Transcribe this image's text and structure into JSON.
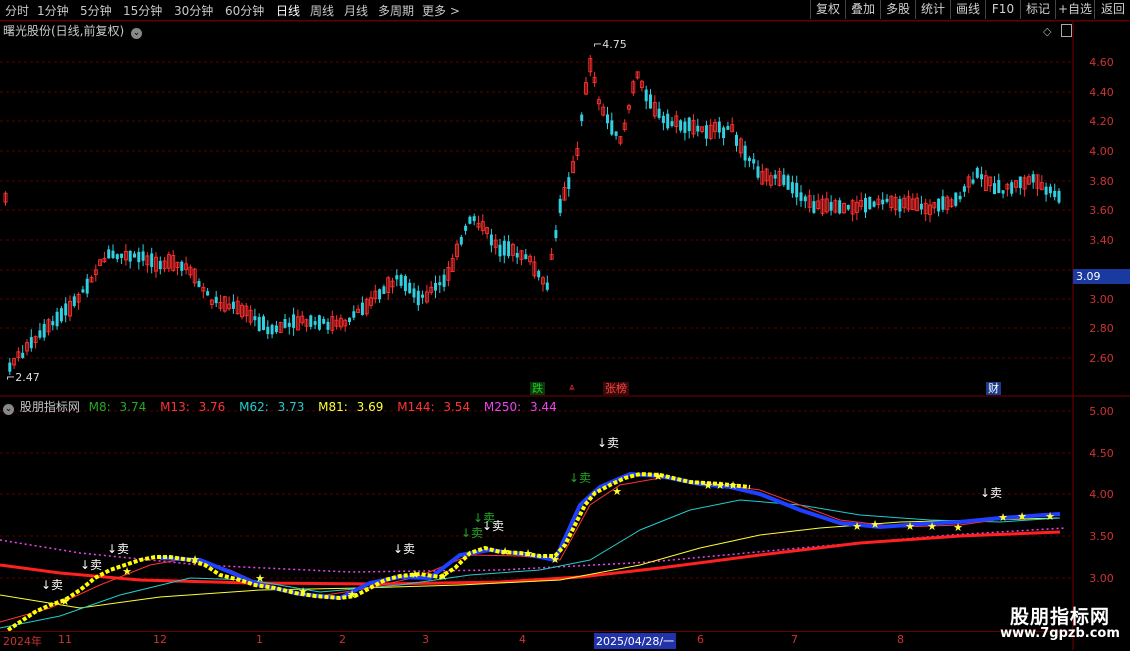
{
  "toolbar": {
    "timeframes": [
      "分时",
      "1分钟",
      "5分钟",
      "15分钟",
      "30分钟",
      "60分钟",
      "日线",
      "周线",
      "月线",
      "多周期",
      "更多 >"
    ],
    "active": "日线",
    "buttons": [
      "复权",
      "叠加",
      "多股",
      "统计",
      "画线",
      "F10",
      "标记",
      "+自选",
      "返回"
    ]
  },
  "price_panel": {
    "title": "曙光股份(日线,前复权)",
    "axis_ticks": [
      "4.60",
      "4.40",
      "4.20",
      "4.00",
      "3.80",
      "3.60",
      "3.40",
      "3.00",
      "2.80",
      "2.60"
    ],
    "current_price": "3.09",
    "high_label": "4.75",
    "low_label": "2.47",
    "tags": [
      {
        "text": "跌",
        "color": "#22aa22",
        "bg": "#0a3a0a"
      },
      {
        "text": "张榜",
        "color": "#ff4444",
        "bg": "#3a0a0a"
      },
      {
        "text": "财",
        "color": "#ffffff",
        "bg": "#1a3a8a"
      }
    ]
  },
  "indicator_panel": {
    "name": "股朋指标网",
    "legend": [
      {
        "label": "M8:",
        "value": "3.74",
        "color": "#22aa22"
      },
      {
        "label": "M13:",
        "value": "3.76",
        "color": "#ff3333"
      },
      {
        "label": "M62:",
        "value": "3.73",
        "color": "#22cccc"
      },
      {
        "label": "M81:",
        "value": "3.69",
        "color": "#ffff33"
      },
      {
        "label": "M144:",
        "value": "3.54",
        "color": "#ff3333"
      },
      {
        "label": "M250:",
        "value": "3.44",
        "color": "#ee44ee"
      }
    ],
    "axis_ticks": [
      "5.00",
      "4.50",
      "4.00",
      "3.50",
      "3.00"
    ],
    "sell_label": "↓卖"
  },
  "date_axis": {
    "labels": [
      "2024年",
      "11",
      "12",
      "1",
      "2",
      "3",
      "4",
      "2025/04/28/一",
      "6",
      "7",
      "8"
    ]
  },
  "watermark": {
    "title": "股朋指标网",
    "url": "www.7gpzb.com"
  },
  "colors": {
    "up": "#ff3030",
    "down": "#30d0e0",
    "grid": "#5a0000",
    "axis_text": "#cc3333",
    "active_tab": "#ffffff"
  }
}
